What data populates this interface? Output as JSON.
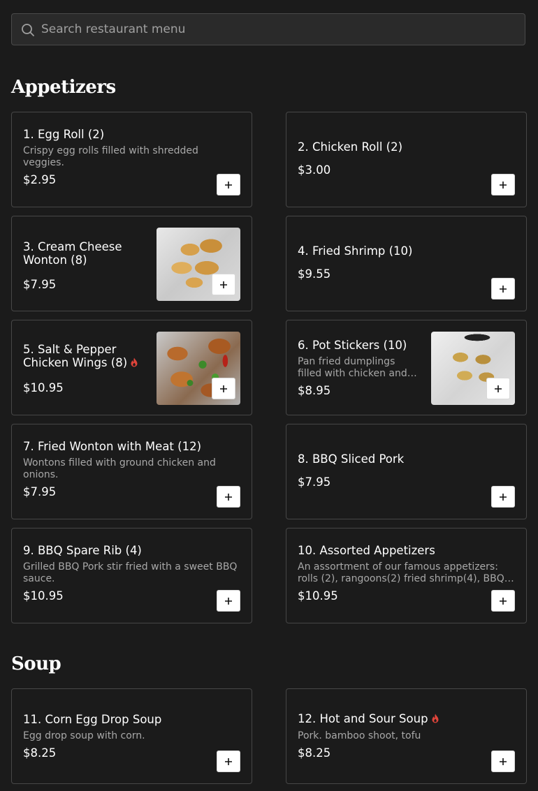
{
  "search": {
    "placeholder": "Search restaurant menu"
  },
  "colors": {
    "background": "#1b1b1b",
    "card_border": "#474747",
    "spicy_icon": "#e0443a",
    "button_bg": "#ffffff"
  },
  "sections": [
    {
      "title": "Appetizers",
      "items": [
        {
          "name": "1. Egg Roll (2)",
          "description": "Crispy egg rolls filled with shredded veggies.",
          "price": "$2.95"
        },
        {
          "name": "2. Chicken Roll (2)",
          "price": "$3.00"
        },
        {
          "name": "3. Cream Cheese Wonton (8)",
          "price": "$7.95",
          "image": "wonton-photo"
        },
        {
          "name": "4. Fried Shrimp (10)",
          "price": "$9.55"
        },
        {
          "name": "5. Salt & Pepper Chicken Wings (8)",
          "price": "$10.95",
          "spicy": true,
          "image": "wings-photo"
        },
        {
          "name": "6. Pot Stickers (10)",
          "description": "Pan fried dumplings filled with chicken and green onions.",
          "price": "$8.95",
          "image": "potstickers-photo"
        },
        {
          "name": "7. Fried Wonton with Meat (12)",
          "description": "Wontons filled with ground chicken and onions.",
          "price": "$7.95"
        },
        {
          "name": "8. BBQ Sliced Pork",
          "price": "$7.95"
        },
        {
          "name": "9. BBQ Spare Rib (4)",
          "description": "Grilled BBQ Pork stir fried with a sweet BBQ sauce.",
          "price": "$10.95"
        },
        {
          "name": "10. Assorted Appetizers",
          "description": "An assortment of our famous appetizers: rolls (2), rangoons(2) fried shrimp(4), BBQ pork.",
          "price": "$10.95"
        }
      ]
    },
    {
      "title": "Soup",
      "items": [
        {
          "name": "11. Corn Egg Drop Soup",
          "description": "Egg drop soup with corn.",
          "price": "$8.25"
        },
        {
          "name": "12. Hot and Sour Soup",
          "description": "Pork. bamboo shoot, tofu",
          "price": "$8.25",
          "spicy": true
        }
      ]
    }
  ]
}
